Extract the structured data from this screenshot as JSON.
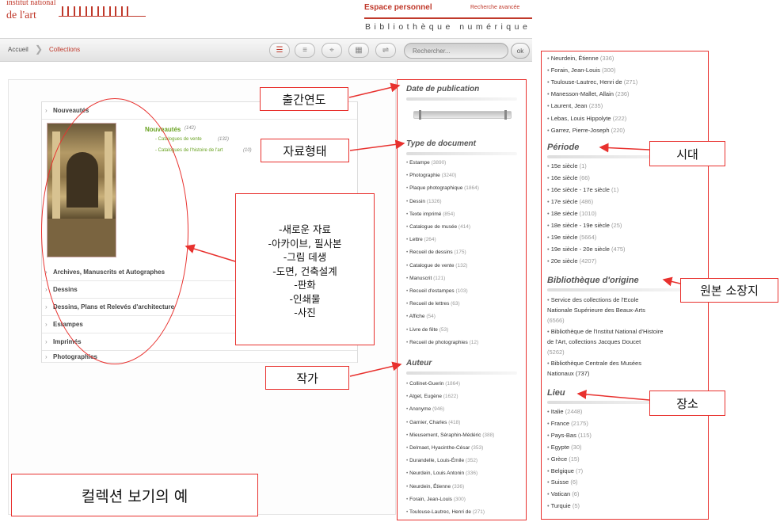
{
  "header": {
    "logo_top": "institut national",
    "logo_text": "de l'art",
    "espace": "Espace personnel",
    "recherche_avancee": "Recherche avancée",
    "bibliotheque": "Bibliothèque numérique"
  },
  "toolbar": {
    "crumb_home": "Accueil",
    "crumb_sep": "❯",
    "crumb_current": "Collections",
    "search_placeholder": "Rechercher...",
    "ok_label": "ok",
    "view_buttons": [
      {
        "icon": "tree-view-icon",
        "glyph": "☰",
        "active": true
      },
      {
        "icon": "list-view-icon",
        "glyph": "≡",
        "active": false
      },
      {
        "icon": "map-pin-icon",
        "glyph": "⌖",
        "active": false
      },
      {
        "icon": "grid-view-icon",
        "glyph": "▦",
        "active": false
      },
      {
        "icon": "timeline-view-icon",
        "glyph": "⇌",
        "active": false
      }
    ]
  },
  "collections": {
    "header": "Nouveautés",
    "nouveautes": {
      "label": "Nouveautés",
      "count": "(142)"
    },
    "sub_items": [
      {
        "label": "- Catalogues de vente",
        "count": "(132)"
      },
      {
        "label": "- Catalogues de l'histoire de l'art",
        "count": "(10)"
      }
    ],
    "rows": [
      "Archives, Manuscrits et Autographes",
      "Dessins",
      "Dessins, Plans et Relevés d'architecture",
      "Estampes",
      "Imprimés",
      "Photographies"
    ]
  },
  "facets_mid": {
    "date_title": "Date de publication",
    "type_title": "Type de document",
    "type_items": [
      {
        "label": "Estampe",
        "n": "(3890)"
      },
      {
        "label": "Photographie",
        "n": "(3240)"
      },
      {
        "label": "Plaque photographique",
        "n": "(1864)"
      },
      {
        "label": "Dessin",
        "n": "(1326)"
      },
      {
        "label": "Texte imprimé",
        "n": "(854)"
      },
      {
        "label": "Catalogue de musée",
        "n": "(414)"
      },
      {
        "label": "Lettre",
        "n": "(264)"
      },
      {
        "label": "Recueil de dessins",
        "n": "(175)"
      },
      {
        "label": "Catalogue de vente",
        "n": "(132)"
      },
      {
        "label": "Manuscrit",
        "n": "(121)"
      },
      {
        "label": "Recueil d'estampes",
        "n": "(103)"
      },
      {
        "label": "Recueil de lettres",
        "n": "(63)"
      },
      {
        "label": "Affiche",
        "n": "(54)"
      },
      {
        "label": "Livre de fête",
        "n": "(53)"
      },
      {
        "label": "Recueil de photographies",
        "n": "(12)"
      }
    ],
    "auteur_title": "Auteur",
    "auteur_items": [
      {
        "label": "Collinet-Guerin",
        "n": "(1864)"
      },
      {
        "label": "Atget, Eugène",
        "n": "(1622)"
      },
      {
        "label": "Anonyme",
        "n": "(946)"
      },
      {
        "label": "Garnier, Charles",
        "n": "(418)"
      },
      {
        "label": "Mieusement, Séraphin-Médéric",
        "n": "(388)"
      },
      {
        "label": "Delmaet, Hyacinthe-César",
        "n": "(353)"
      },
      {
        "label": "Durandelle, Louis-Émile",
        "n": "(352)"
      },
      {
        "label": "Neurdein, Louis Antonin",
        "n": "(336)"
      },
      {
        "label": "Neurdein, Étienne",
        "n": "(336)"
      },
      {
        "label": "Forain, Jean-Louis",
        "n": "(300)"
      },
      {
        "label": "Toulouse-Lautrec, Henri de",
        "n": "(271)"
      }
    ]
  },
  "facets_right": {
    "auteur_cont": [
      {
        "label": "Neurdein, Étienne",
        "n": "(336)"
      },
      {
        "label": "Forain, Jean-Louis",
        "n": "(300)"
      },
      {
        "label": "Toulouse-Lautrec, Henri de",
        "n": "(271)"
      },
      {
        "label": "Manesson-Mallet, Allain",
        "n": "(236)"
      },
      {
        "label": "Laurent, Jean",
        "n": "(235)"
      },
      {
        "label": "Lebas, Louis Hippolyte",
        "n": "(222)"
      },
      {
        "label": "Garrez, Pierre-Joseph",
        "n": "(220)"
      }
    ],
    "periode_title": "Période",
    "periode_items": [
      {
        "label": "15e siècle",
        "n": "(1)"
      },
      {
        "label": "16e siècle",
        "n": "(66)"
      },
      {
        "label": "16e siècle - 17e siècle",
        "n": "(1)"
      },
      {
        "label": "17e siècle",
        "n": "(486)"
      },
      {
        "label": "18e siècle",
        "n": "(1010)"
      },
      {
        "label": "18e siècle - 19e siècle",
        "n": "(25)"
      },
      {
        "label": "19e siècle",
        "n": "(5664)"
      },
      {
        "label": "19e siècle - 20e siècle",
        "n": "(475)"
      },
      {
        "label": "20e siècle",
        "n": "(4207)"
      }
    ],
    "biblio_title": "Bibliothèque d'origine",
    "biblio_items": [
      {
        "line1": "Service des collections de l'Ecole",
        "line2": "Nationale Supérieure des Beaux-Arts",
        "line3": "(6566)"
      },
      {
        "line1": "Bibliothèque de l'Institut National d'Histoire",
        "line2": "de l'Art, collections Jacques Doucet",
        "line3": "(5262)"
      },
      {
        "line1": "Bibliothèque Centrale des Musées",
        "line2": "Nationaux (737)",
        "line3": ""
      }
    ],
    "lieu_title": "Lieu",
    "lieu_items": [
      {
        "label": "Italie",
        "n": "(2448)"
      },
      {
        "label": "France",
        "n": "(2175)"
      },
      {
        "label": "Pays-Bas",
        "n": "(115)"
      },
      {
        "label": "Egypte",
        "n": "(30)"
      },
      {
        "label": "Grèce",
        "n": "(15)"
      },
      {
        "label": "Belgique",
        "n": "(7)"
      },
      {
        "label": "Suisse",
        "n": "(6)"
      },
      {
        "label": "Vatican",
        "n": "(6)"
      },
      {
        "label": "Turquie",
        "n": "(5)"
      }
    ]
  },
  "annotations": {
    "pub_year": "출간연도",
    "doc_type": "자료형태",
    "author": "작가",
    "period": "시대",
    "origin": "원본 소장지",
    "place": "장소",
    "example": "컬렉션 보기의 예",
    "list": [
      "-새로운 자료",
      "-아카이브, 필사본",
      "-그림 데생",
      "-도면, 건축설계",
      "-판화",
      "-인쇄물",
      "-사진"
    ]
  },
  "colors": {
    "brand_red": "#c0392b",
    "annotation_red": "#e8312e",
    "green_link": "#6aa323"
  }
}
